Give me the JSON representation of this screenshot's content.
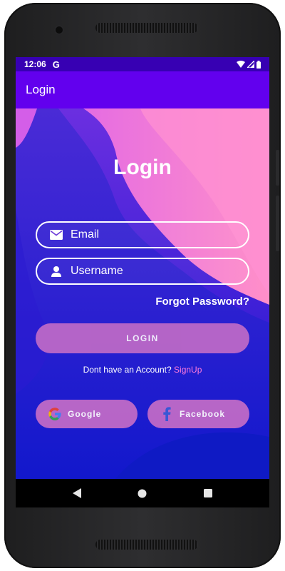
{
  "status_bar": {
    "time": "12:06",
    "notification_icon": "G",
    "icons": [
      "wifi-icon",
      "signal-icon",
      "battery-icon"
    ]
  },
  "app_bar": {
    "title": "Login"
  },
  "login": {
    "heading": "Login",
    "email": {
      "placeholder": "Email",
      "value": "",
      "icon": "mail-icon"
    },
    "username": {
      "placeholder": "Username",
      "value": "",
      "icon": "person-icon"
    },
    "forgot_password": "Forgot Password?",
    "login_button": "LOGIN",
    "no_account_text": "Dont have an Account?",
    "signup_link": "SignUp"
  },
  "social": {
    "google": {
      "label": "Google",
      "icon": "google-icon"
    },
    "facebook": {
      "label": "Facebook",
      "icon": "facebook-icon"
    }
  },
  "nav_bar": {
    "icons": [
      "back-icon",
      "home-icon",
      "recents-icon"
    ]
  },
  "colors": {
    "status_bar": "#3700b3",
    "app_bar": "#6200ee",
    "button_fill": "#c06ac7",
    "signup_link": "#ff7bdc",
    "background_pink": "#ff8ccf",
    "background_blue": "#1a24d4"
  }
}
